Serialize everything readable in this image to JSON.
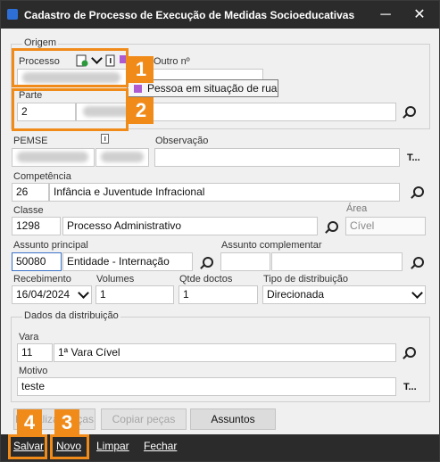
{
  "window": {
    "title": "Cadastro de Processo de Execução de Medidas Socioeducativas",
    "minimize": "─",
    "close": "✕"
  },
  "origem": {
    "legend": "Origem",
    "processo_label": "Processo",
    "outro_label": "Outro nº",
    "tooltip": "Pessoa em situação de rua"
  },
  "parte": {
    "label": "Parte",
    "value": "2"
  },
  "pemse": {
    "label": "PEMSE"
  },
  "observacao": {
    "label": "Observação",
    "t_button": "T..."
  },
  "competencia": {
    "label": "Competência",
    "code": "26",
    "description": "Infância e Juventude Infracional"
  },
  "classe": {
    "label": "Classe",
    "code": "1298",
    "description": "Processo Administrativo"
  },
  "area": {
    "label": "Área",
    "value": "Cível"
  },
  "assunto_principal": {
    "label": "Assunto principal",
    "code": "50080",
    "description": "Entidade - Internação"
  },
  "assunto_complementar": {
    "label": "Assunto complementar"
  },
  "recebimento": {
    "label": "Recebimento",
    "value": "16/04/2024"
  },
  "volumes": {
    "label": "Volumes",
    "value": "1"
  },
  "qtde_doctos": {
    "label": "Qtde doctos",
    "value": "1"
  },
  "tipo_distribuicao": {
    "label": "Tipo de distribuição",
    "value": "Direcionada"
  },
  "distribuicao": {
    "legend": "Dados da distribuição",
    "vara_label": "Vara",
    "vara_code": "11",
    "vara_description": "1ª Vara Cível",
    "motivo_label": "Motivo",
    "motivo_value": "teste",
    "t_button": "T..."
  },
  "action_buttons": {
    "digitalizacao": "Digitalizar peças",
    "copiar": "Copiar peças",
    "assuntos": "Assuntos"
  },
  "bottom_bar": {
    "salvar": "Salvar",
    "novo": "Novo",
    "limpar": "Limpar",
    "fechar": "Fechar"
  },
  "annotations": {
    "accent_color": "#f08b1a",
    "badges": [
      "1",
      "2",
      "3",
      "4"
    ]
  }
}
